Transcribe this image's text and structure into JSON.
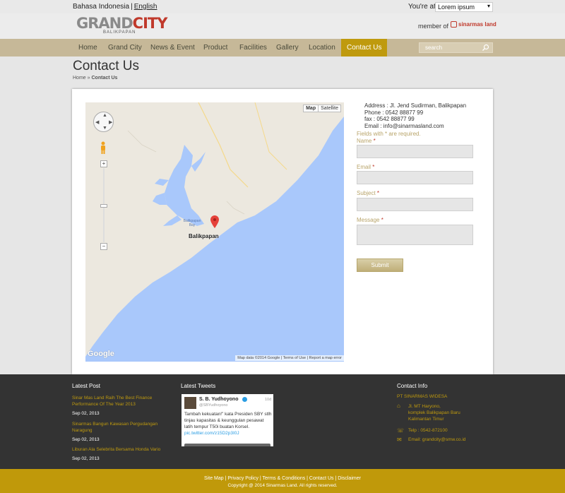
{
  "topbar": {
    "lang_id": "Bahasa Indonesia",
    "lang_sep": "|",
    "lang_en": "English",
    "at_label": "You're at",
    "property_select": "Lorem ipsum"
  },
  "header": {
    "logo_grand": "GRAND",
    "logo_city": "CITY",
    "logo_sub": "BALIKPAPAN",
    "member_label": "member of",
    "partner": "sinarmas land"
  },
  "nav": {
    "items": [
      "Home",
      "Grand City",
      "News & Event",
      "Product",
      "Facilities",
      "Gallery",
      "Location",
      "Contact Us"
    ],
    "active": "Contact Us",
    "search_placeholder": "search"
  },
  "page": {
    "title": "Contact Us",
    "breadcrumb_home": "Home",
    "breadcrumb_sep": "»",
    "breadcrumb_current": "Contact Us"
  },
  "map": {
    "type_map": "Map",
    "type_satellite": "Satellite",
    "city": "Balikpapan",
    "bay": "Balikpapan Bay",
    "zoom_in": "+",
    "zoom_out": "−",
    "logo": "Google",
    "attribution": "Map data ©2014 Google  |  Terms of Use  |  Report a map error"
  },
  "contact": {
    "address": "Address : Jl. Jend Sudirman, Balikpapan",
    "phone": "Phone : 0542 88877 99",
    "fax": "fax : 0542 88877 99",
    "email": "Email : info@sinarmasland.com",
    "required_note": "Fields with * are required.",
    "fields": {
      "name": "Name",
      "email": "Email",
      "subject": "Subject",
      "message": "Message"
    },
    "star": "*",
    "submit": "Submit"
  },
  "footer": {
    "latest_post_heading": "Latest Post",
    "posts": [
      {
        "title": "Sinar Mas Land Raih The Best Finance Performance Of The Year 2013",
        "date": "Sep 02, 2013"
      },
      {
        "title": "Sinarmas Bangun Kawasan Pergudangan Naragung",
        "date": "Sep 02, 2013"
      },
      {
        "title": "Liburan Ala Selebrita Bersama Honda Vario",
        "date": "Sep 02, 2013"
      }
    ],
    "latest_tweets_heading": "Latest Tweets",
    "tweet": {
      "name": "S. B. Yudhoyono",
      "handle": "@SBYudhoyono",
      "time": "10d",
      "text": "Tambah kekuatan!” kata Presiden SBY stlh tinjau kapasitas & keunggulan pesawat latih tempur T50i buatan Korsel.",
      "link": "pic.twitter.com/z15D2p3I0J"
    },
    "contact_info_heading": "Contact Info",
    "company": "PT SINARMAS WIDESA",
    "address_lines": [
      "Jl. MT Haryono,",
      "komplek Balikpapan Baru",
      "Kalimantan Timur"
    ],
    "phone": "Telp : 0542-872100",
    "email": "Email: grandcity@smw.co.id"
  },
  "bottom": {
    "links": "Site Map | Privacy Policy | Terms & Conditions | Contact Us | Disclaimer",
    "copyright": "Copyright @ 2014 Sinarmas Land. All rights reserved."
  }
}
